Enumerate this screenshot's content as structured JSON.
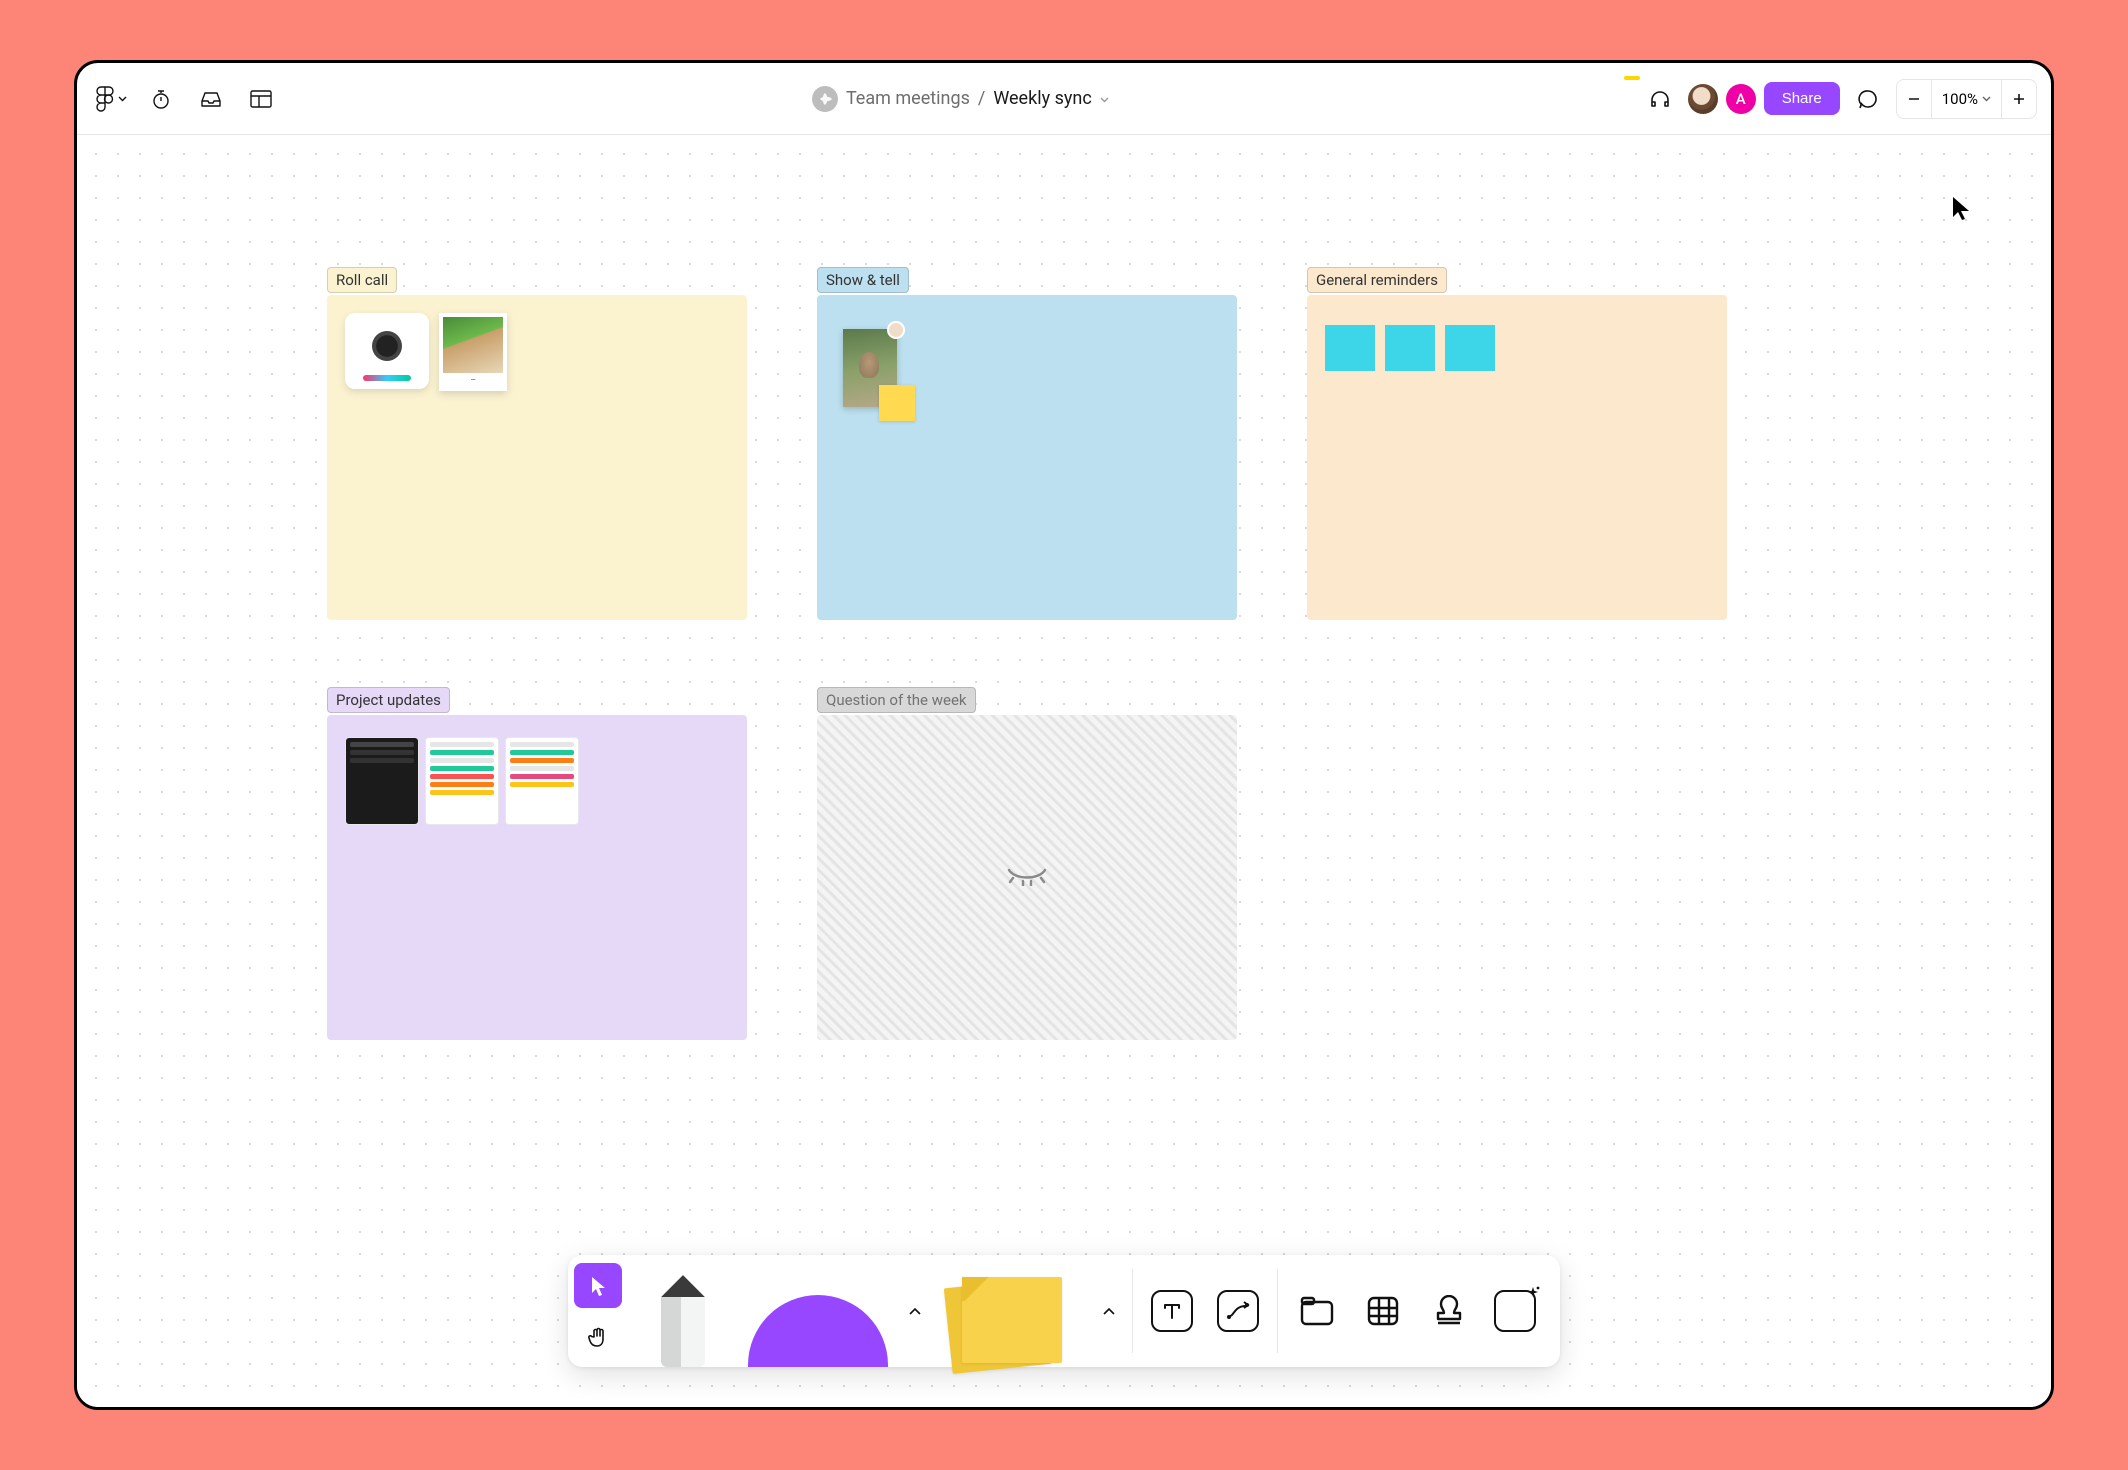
{
  "breadcrumb": {
    "team": "Team meetings",
    "file": "Weekly sync"
  },
  "topbar": {
    "share_label": "Share",
    "zoom_value": "100%",
    "avatar_letter": "A"
  },
  "sections": {
    "rollcall": {
      "label": "Roll call"
    },
    "showtell": {
      "label": "Show & tell"
    },
    "reminders": {
      "label": "General reminders"
    },
    "updates": {
      "label": "Project updates"
    },
    "question": {
      "label": "Question of the week"
    }
  }
}
